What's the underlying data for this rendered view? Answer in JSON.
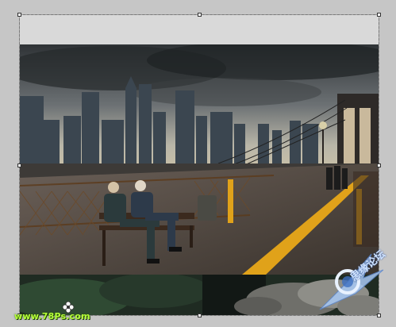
{
  "canvas": {
    "background": "#c6c6c6",
    "document_blank_color": "#d9d9d9"
  },
  "photo": {
    "subject": "bridge-with-city-skyline",
    "sky_color": "#4a4f52",
    "deck_color": "#5a4e45",
    "accent_line_color": "#e0a21a"
  },
  "watermarks": {
    "left_text": "www.78Ps.com",
    "right_logo_icon": "wing-swirl-icon",
    "right_text": "思缘论坛"
  },
  "icons": {
    "left_badge": "flower-icon"
  }
}
